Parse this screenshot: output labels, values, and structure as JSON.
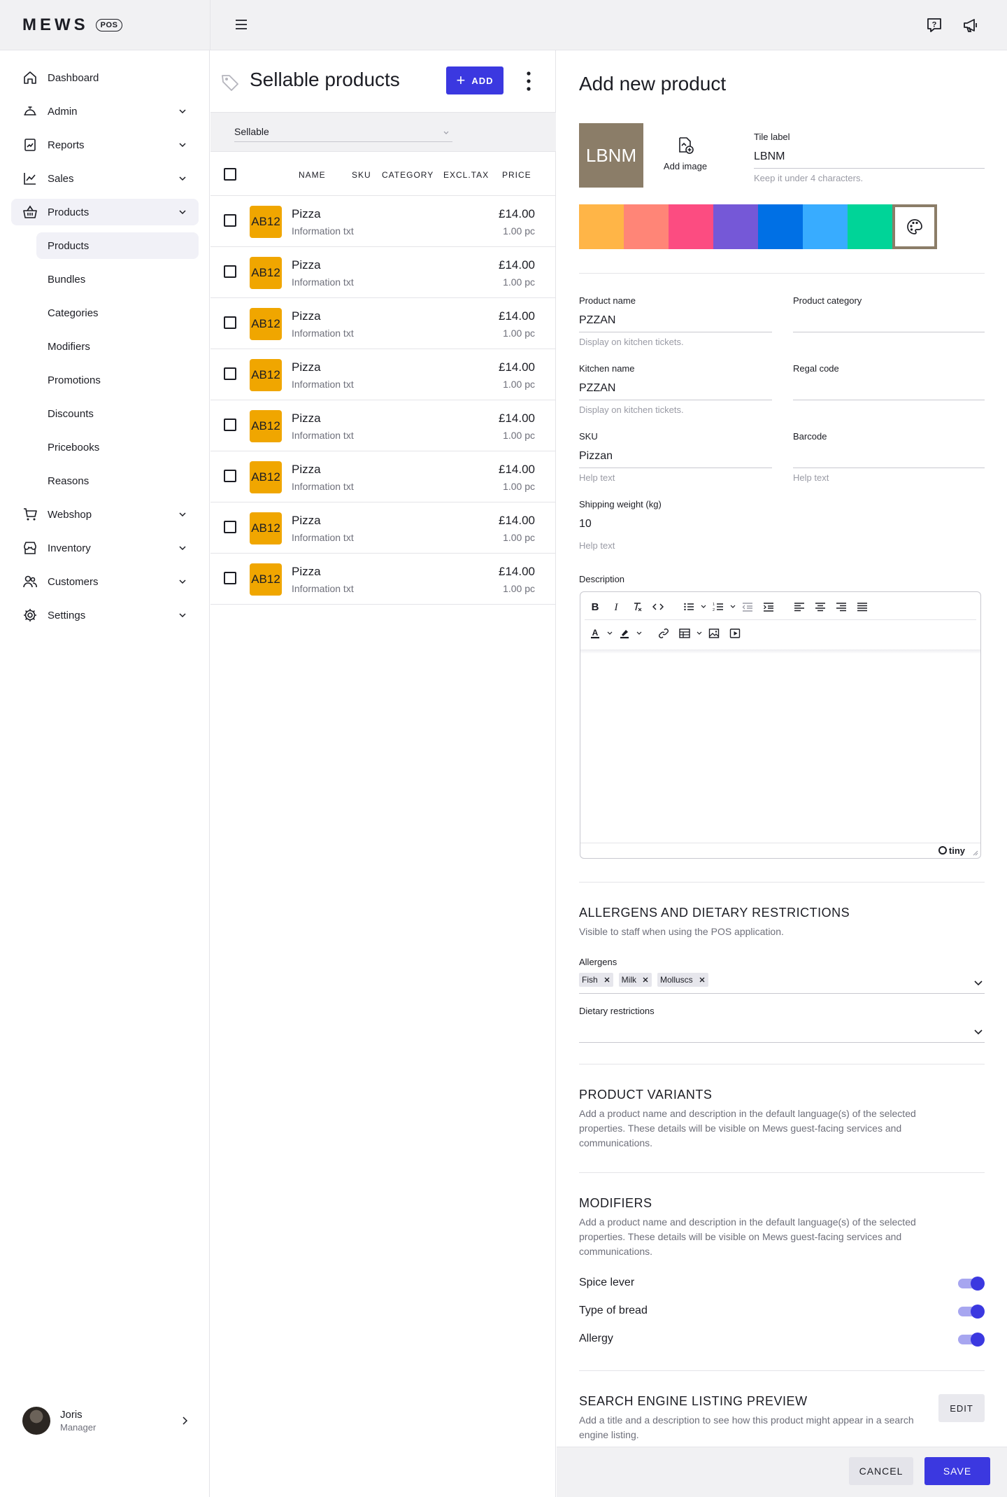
{
  "app": {
    "logo_text": "MEWS",
    "logo_badge": "POS"
  },
  "topbar": {
    "menu_icon": "hamburger-icon",
    "help_icon": "help-chat-icon",
    "announce_icon": "megaphone-icon"
  },
  "sidebar": {
    "items": [
      {
        "label": "Dashboard",
        "icon": "home-icon",
        "expandable": false
      },
      {
        "label": "Admin",
        "icon": "service-bell-icon",
        "expandable": true
      },
      {
        "label": "Reports",
        "icon": "report-chart-icon",
        "expandable": true
      },
      {
        "label": "Sales",
        "icon": "line-chart-icon",
        "expandable": true
      },
      {
        "label": "Products",
        "icon": "basket-icon",
        "expandable": true,
        "active": true
      }
    ],
    "sub_items": [
      {
        "label": "Products",
        "active": true
      },
      {
        "label": "Bundles"
      },
      {
        "label": "Categories"
      },
      {
        "label": "Modifiers"
      },
      {
        "label": "Promotions"
      },
      {
        "label": "Discounts"
      },
      {
        "label": "Pricebooks"
      },
      {
        "label": "Reasons"
      }
    ],
    "items_after": [
      {
        "label": "Webshop",
        "icon": "cart-icon",
        "expandable": true
      },
      {
        "label": "Inventory",
        "icon": "store-icon",
        "expandable": true
      },
      {
        "label": "Customers",
        "icon": "users-icon",
        "expandable": true
      },
      {
        "label": "Settings",
        "icon": "gear-icon",
        "expandable": true
      }
    ],
    "user": {
      "name": "Joris",
      "role": "Manager"
    }
  },
  "list": {
    "title": "Sellable products",
    "add_label": "ADD",
    "filter_value": "Sellable",
    "columns": [
      "NAME",
      "SKU",
      "CATEGORY",
      "EXCL.TAX",
      "PRICE"
    ],
    "rows": [
      {
        "badge": "AB12",
        "name": "Pizza",
        "info": "Information txt",
        "price": "£14.00",
        "qty": "1.00 pc"
      },
      {
        "badge": "AB12",
        "name": "Pizza",
        "info": "Information txt",
        "price": "£14.00",
        "qty": "1.00 pc"
      },
      {
        "badge": "AB12",
        "name": "Pizza",
        "info": "Information txt",
        "price": "£14.00",
        "qty": "1.00 pc"
      },
      {
        "badge": "AB12",
        "name": "Pizza",
        "info": "Information txt",
        "price": "£14.00",
        "qty": "1.00 pc"
      },
      {
        "badge": "AB12",
        "name": "Pizza",
        "info": "Information txt",
        "price": "£14.00",
        "qty": "1.00 pc"
      },
      {
        "badge": "AB12",
        "name": "Pizza",
        "info": "Information txt",
        "price": "£14.00",
        "qty": "1.00 pc"
      },
      {
        "badge": "AB12",
        "name": "Pizza",
        "info": "Information txt",
        "price": "£14.00",
        "qty": "1.00 pc"
      },
      {
        "badge": "AB12",
        "name": "Pizza",
        "info": "Information txt",
        "price": "£14.00",
        "qty": "1.00 pc"
      }
    ]
  },
  "form": {
    "title": "Add new product",
    "tile_preview": "LBNM",
    "tile_color": "#8b7d68",
    "add_image_label": "Add image",
    "tile_label": {
      "label": "Tile label",
      "value": "LBNM",
      "help": "Keep it under 4 characters."
    },
    "swatches": [
      "#ffb547",
      "#ff8577",
      "#fc4c81",
      "#7558d7",
      "#0070e5",
      "#38acff",
      "#00d498"
    ],
    "product_name": {
      "label": "Product name",
      "value": "PZZAN",
      "help": "Display on kitchen tickets."
    },
    "product_category": {
      "label": "Product category",
      "value": ""
    },
    "kitchen_name": {
      "label": "Kitchen name",
      "value": "PZZAN",
      "help": "Display on kitchen tickets."
    },
    "regal_code": {
      "label": "Regal code",
      "value": ""
    },
    "sku": {
      "label": "SKU",
      "value": "Pizzan",
      "help": "Help text"
    },
    "barcode": {
      "label": "Barcode",
      "value": "",
      "help": "Help text"
    },
    "shipping_weight": {
      "label": "Shipping weight (kg)",
      "value": "10",
      "help": "Help text"
    },
    "description_label": "Description",
    "editor_brand": "tiny",
    "allergens_section": {
      "title": "ALLERGENS AND DIETARY RESTRICTIONS",
      "desc": "Visible to staff when using the POS application.",
      "allergens_label": "Allergens",
      "allergens": [
        "Fish",
        "Milk",
        "Molluscs"
      ],
      "dietary_label": "Dietary restrictions"
    },
    "variants_section": {
      "title": "PRODUCT VARIANTS",
      "desc": "Add a product name and description in the default language(s) of the selected properties. These details will be visible on Mews guest-facing services and communications."
    },
    "modifiers_section": {
      "title": "MODIFIERS",
      "desc": "Add a product name and description in the default language(s) of the selected properties. These details will be visible on Mews guest-facing services and communications.",
      "items": [
        {
          "label": "Spice lever",
          "on": true
        },
        {
          "label": "Type of bread",
          "on": true
        },
        {
          "label": "Allergy",
          "on": true
        }
      ]
    },
    "seo_section": {
      "title": "SEARCH ENGINE LISTING PREVIEW",
      "desc": "Add a title and a description to see how this product might appear in a search engine listing.",
      "edit_label": "EDIT"
    },
    "cancel_label": "CANCEL",
    "save_label": "SAVE"
  },
  "colors": {
    "accent": "#3b38e0",
    "badge": "#f0a600"
  }
}
